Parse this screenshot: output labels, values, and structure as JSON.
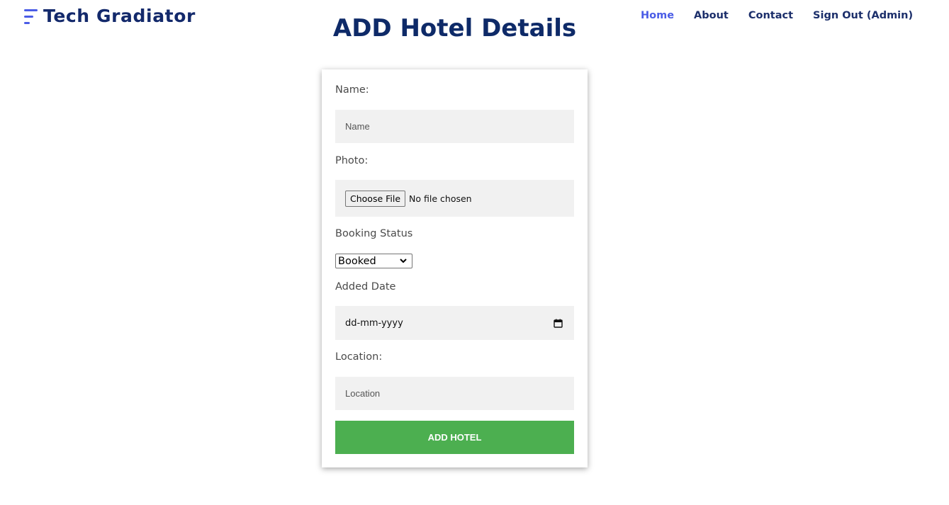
{
  "brand": {
    "name": "Tech Gradiator",
    "icon": "menu-lines-icon",
    "icon_color": "#4a5ce6"
  },
  "nav": {
    "items": [
      {
        "label": "Home",
        "active": true
      },
      {
        "label": "About"
      },
      {
        "label": "Contact"
      },
      {
        "label": "Sign Out (Admin)"
      }
    ]
  },
  "page": {
    "title": "ADD Hotel Details"
  },
  "form": {
    "name_label": "Name:",
    "name_placeholder": "Name",
    "photo_label": "Photo:",
    "file_button": "Choose File",
    "file_status": "No file chosen",
    "booking_label": "Booking Status",
    "booking_selected": "Booked",
    "date_label": "Added Date",
    "date_placeholder": "dd-mm-yyyy",
    "location_label": "Location:",
    "location_placeholder": "Location",
    "submit_label": "ADD HOTEL"
  },
  "colors": {
    "accent": "#4a5ce6",
    "title": "#0e2a68",
    "submit": "#4caf50",
    "field_bg": "#f1f1f1"
  }
}
